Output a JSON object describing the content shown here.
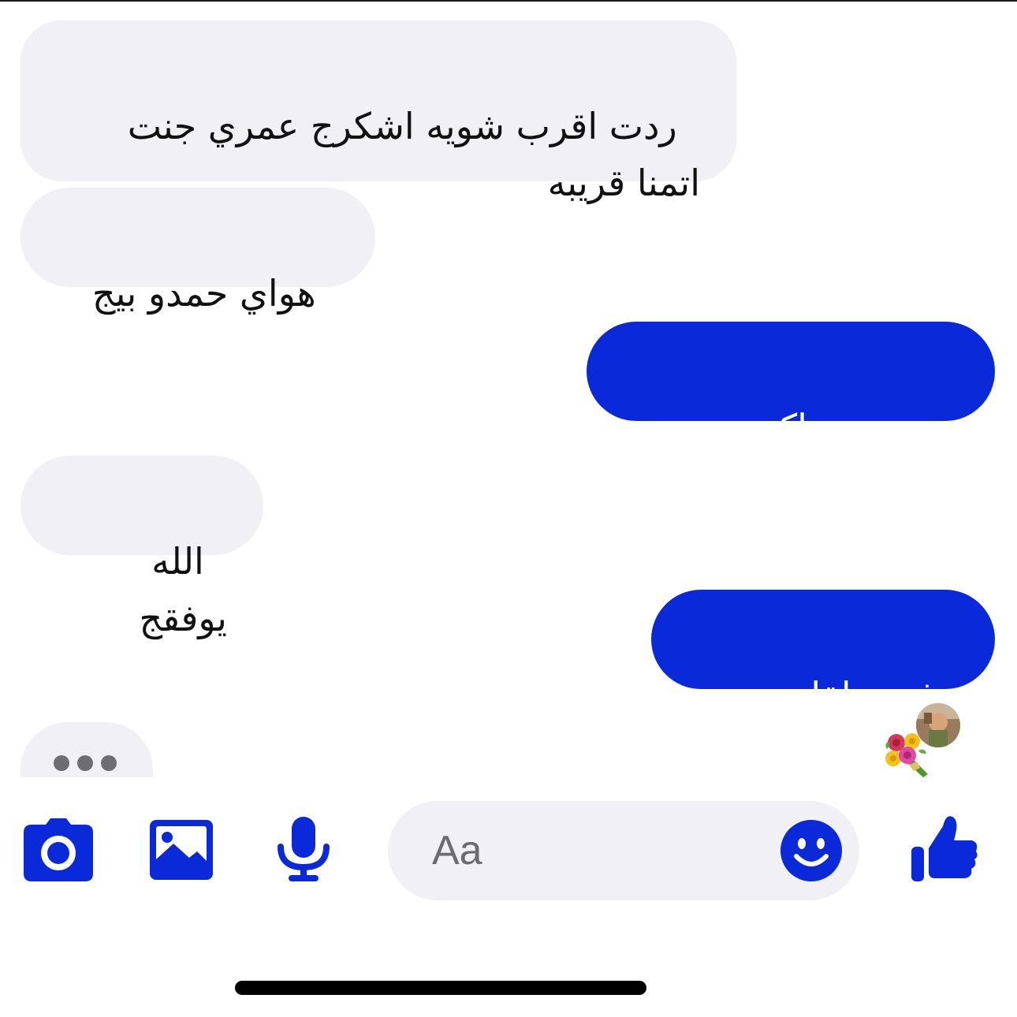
{
  "messages": [
    {
      "id": "msg1",
      "direction": "incoming",
      "text": "ردت اقرب شويه اشكرج عمري جنت\nاتمنا قريبه"
    },
    {
      "id": "msg2",
      "direction": "incoming",
      "text": "هواي حمدو بيج"
    },
    {
      "id": "msg3",
      "direction": "outgoing",
      "text": "حبيبتي ماكو نصيب"
    },
    {
      "id": "msg4",
      "direction": "incoming",
      "text": "الله يوفقج"
    },
    {
      "id": "msg5",
      "direction": "outgoing",
      "text": "فدوة لقلبج",
      "emoji": "bouquet-icon"
    }
  ],
  "composer": {
    "placeholder": "Aa",
    "icons": [
      "camera-icon",
      "gallery-icon",
      "microphone-icon",
      "emoji-icon",
      "thumbs-up-icon"
    ]
  },
  "colors": {
    "accent": "#0a29d8",
    "incoming_bubble": "#f0f0f5",
    "input_bg": "#f0f0f5"
  }
}
